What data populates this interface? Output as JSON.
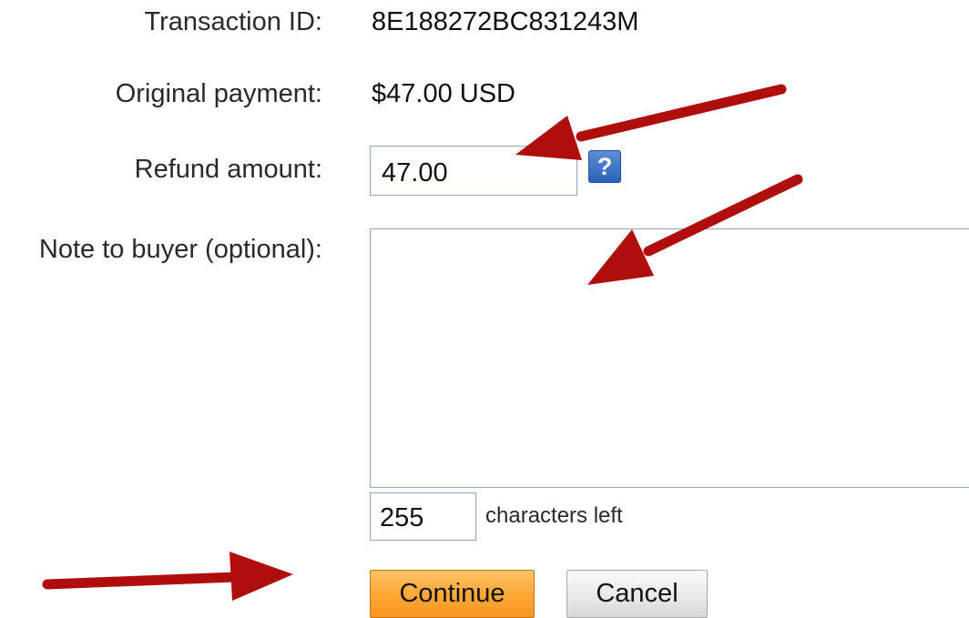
{
  "form": {
    "transaction_id_label": "Transaction ID:",
    "transaction_id_value": "8E188272BC831243M",
    "original_payment_label": "Original payment:",
    "original_payment_value": "$47.00 USD",
    "refund_amount_label": "Refund amount:",
    "refund_amount_value": "47.00",
    "help_icon_glyph": "?",
    "note_label": "Note to buyer (optional):",
    "note_value": "",
    "characters_left_value": "255",
    "characters_left_label": "characters left"
  },
  "buttons": {
    "continue_label": "Continue",
    "cancel_label": "Cancel"
  },
  "colors": {
    "annotation_arrow": "#b00d0d",
    "continue_button": "#ffac3d",
    "help_icon": "#2a62b8",
    "input_border": "#8fa9cc"
  },
  "icons": {
    "help": "question-mark-icon",
    "annotation": "arrow-icon"
  }
}
